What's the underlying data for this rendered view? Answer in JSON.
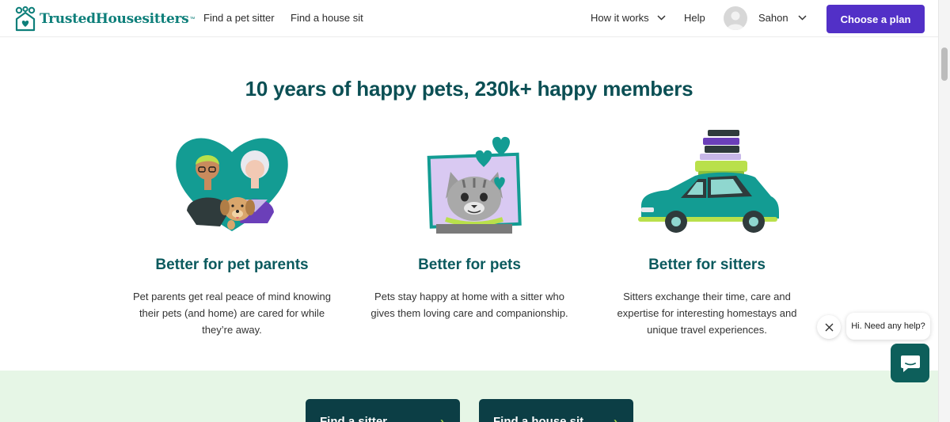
{
  "header": {
    "logo_text": "TrustedHousesitters",
    "logo_tm": "™",
    "nav": {
      "find_sitter": "Find a pet sitter",
      "find_house_sit": "Find a house sit",
      "how_it_works": "How it works",
      "help": "Help",
      "user_name": "Sahon"
    },
    "cta_label": "Choose a plan"
  },
  "section": {
    "headline": "10 years of happy pets, 230k+ happy members",
    "columns": [
      {
        "title": "Better for pet parents",
        "text": "Pet parents get real peace of mind knowing their pets (and home) are cared for while they’re away."
      },
      {
        "title": "Better for pets",
        "text": "Pets stay happy at home with a sitter who gives them loving care and companionship."
      },
      {
        "title": "Better for sitters",
        "text": "Sitters exchange their time, care and expertise for interesting homestays and unique travel experiences."
      }
    ]
  },
  "chat": {
    "prompt": "Hi. Need any help?"
  },
  "band": {
    "btn_sitter": "Find a sitter",
    "btn_house_sit": "Find a house sit",
    "arrow": "›"
  },
  "colors": {
    "brand_teal": "#0e7f7a",
    "cta_purple": "#5230c7",
    "headline": "#0b4f54",
    "band_bg": "#e6f6e6",
    "band_button": "#0c3e45",
    "accent_lime": "#a8d84a"
  },
  "icons": [
    "house-heart-logo-icon",
    "chevron-down-icon",
    "avatar-icon",
    "close-icon",
    "chat-icon",
    "arrow-right-icon"
  ]
}
